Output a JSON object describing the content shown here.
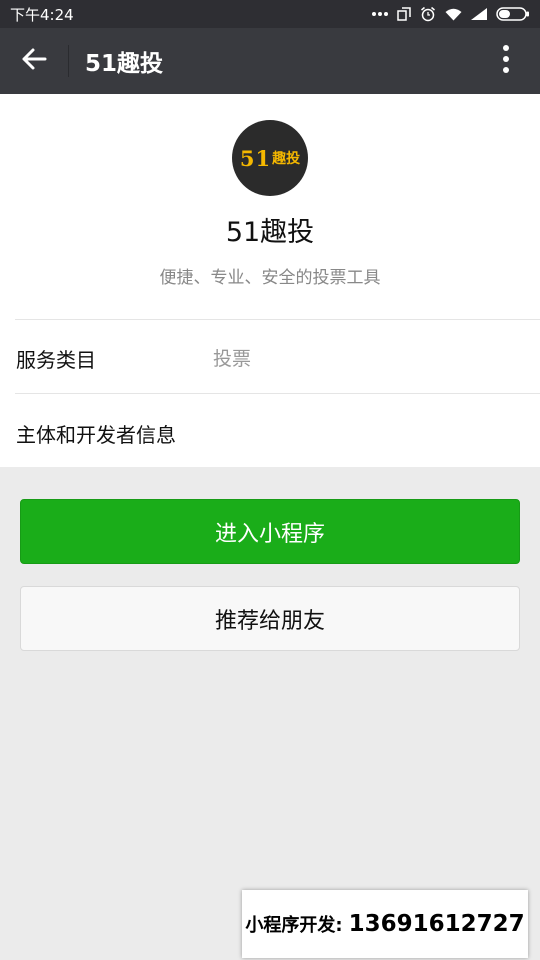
{
  "status_bar": {
    "time": "下午4:24",
    "icons": [
      "more-dots-icon",
      "screen-rotate-icon",
      "alarm-icon",
      "wifi-icon",
      "signal-icon",
      "battery-icon"
    ]
  },
  "title_bar": {
    "title": "51趣投",
    "back_icon": "back-arrow-icon",
    "more_icon": "more-vertical-icon"
  },
  "profile": {
    "logo_number": "51",
    "logo_text": "趣投",
    "name": "51趣投",
    "description": "便捷、专业、安全的投票工具",
    "rows": [
      {
        "label": "服务类目",
        "value": "投票"
      },
      {
        "label": "主体和开发者信息",
        "value": ""
      }
    ]
  },
  "buttons": {
    "enter_label": "进入小程序",
    "recommend_label": "推荐给朋友"
  },
  "watermark": {
    "label": "小程序开发:",
    "phone": "13691612727"
  },
  "colors": {
    "primary_green": "#1aad19",
    "title_bar": "#393a3f",
    "status_bar": "#2e2e33",
    "background": "#ebebeb"
  }
}
